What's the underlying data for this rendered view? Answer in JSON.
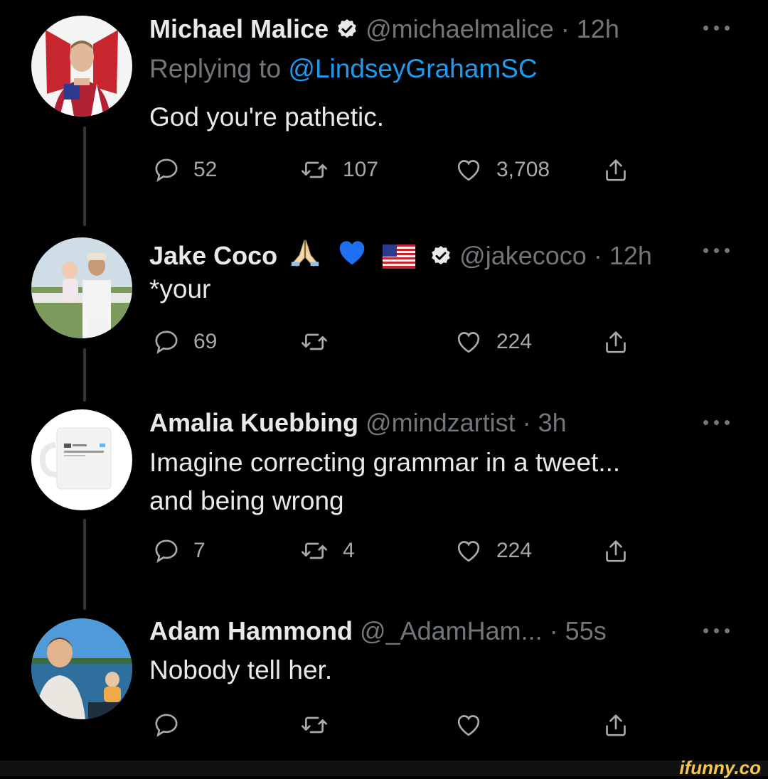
{
  "tweets": [
    {
      "name": "Michael Malice",
      "handle": "@michaelmalice",
      "time": "· 12h",
      "reply_prefix": "Replying to ",
      "reply_to": "@LindseyGrahamSC",
      "text": "God you're pathetic.",
      "replies": "52",
      "retweets": "107",
      "likes": "3,708"
    },
    {
      "name": "Jake Coco",
      "handle": "@jakecoco",
      "time": "· 12h",
      "name_emojis": [
        "folded-hands-emoji",
        "blue-heart-emoji",
        "us-flag-emoji"
      ],
      "text": "*your",
      "replies": "69",
      "retweets": "",
      "likes": "224"
    },
    {
      "name": "Amalia Kuebbing",
      "handle": "@mindzartist",
      "time": "· 3h",
      "text_lines": [
        "Imagine correcting grammar in a tweet...",
        "and being wrong"
      ],
      "replies": "7",
      "retweets": "4",
      "likes": "224"
    },
    {
      "name": "Adam Hammond",
      "handle": "@_AdamHam...",
      "time": "· 55s",
      "text": "Nobody tell her.",
      "replies": "",
      "retweets": "",
      "likes": ""
    }
  ],
  "watermark": "ifunny.co",
  "colors": {
    "background": "#000000",
    "text": "#e7e9ea",
    "muted": "#71767b",
    "link": "#1d9bf0",
    "verified": "#e7e9ea"
  },
  "icons": [
    "reply-icon",
    "retweet-icon",
    "like-icon",
    "share-icon",
    "verified-icon",
    "more-icon"
  ]
}
